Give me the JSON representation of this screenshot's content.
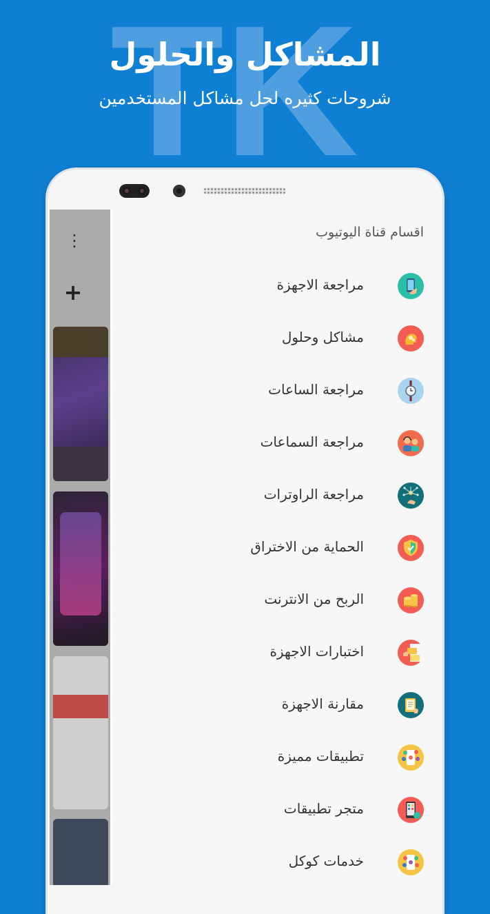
{
  "promo": {
    "watermark": "TK",
    "title": "المشاكل والحلول",
    "subtitle": "شروحات كثيره لحل مشاكل المستخدمين"
  },
  "drawer": {
    "header": "اقسام قناة اليوتيوب",
    "items": [
      {
        "label": "مراجعة الاجهزة",
        "icon": "phone-hand-icon",
        "color": "#2bbfa8"
      },
      {
        "label": "مشاكل وحلول",
        "icon": "head-gears-icon",
        "color": "#f25c54"
      },
      {
        "label": "مراجعة الساعات",
        "icon": "watch-icon",
        "color": "#a8d4ef"
      },
      {
        "label": "مراجعة السماعات",
        "icon": "headphones-people-icon",
        "color": "#f26a4f"
      },
      {
        "label": "مراجعة الراوترات",
        "icon": "network-hand-icon",
        "color": "#13707a"
      },
      {
        "label": "الحماية من الاختراق",
        "icon": "shield-icon",
        "color": "#f25c54"
      },
      {
        "label": "الربح من الانترنت",
        "icon": "coins-icon",
        "color": "#f25c54"
      },
      {
        "label": "اختبارات الاجهزة",
        "icon": "test-cards-icon",
        "color": "#f7f7f7"
      },
      {
        "label": "مقارنة الاجهزة",
        "icon": "tablet-compare-icon",
        "color": "#13707a"
      },
      {
        "label": "تطبيقات مميزة",
        "icon": "apps-phone-icon",
        "color": "#f6c445"
      },
      {
        "label": "متجر تطبيقات",
        "icon": "store-phone-icon",
        "color": "#f25c54"
      },
      {
        "label": "خدمات كوكل",
        "icon": "google-services-icon",
        "color": "#f6c445"
      }
    ]
  },
  "colors": {
    "background": "#0f7fd3",
    "drawer": "#f7f7f7",
    "text": "#333333"
  }
}
